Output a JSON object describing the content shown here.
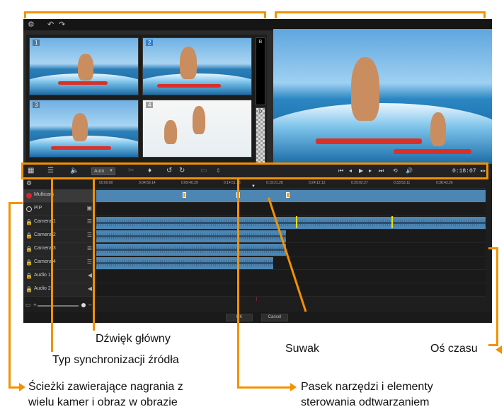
{
  "colors": {
    "callout": "#f39200",
    "clip": "#4d86b3",
    "record": "#d9252b",
    "app_bg": "#2a2a2a"
  },
  "camera_grid": {
    "cells": [
      {
        "num": "1"
      },
      {
        "num": "2"
      },
      {
        "num": "3"
      },
      {
        "num": "4"
      }
    ],
    "side_slots": [
      {
        "label": "B"
      },
      {
        "label": "0"
      }
    ]
  },
  "toolbar": {
    "audio_select_value": "Auto",
    "time_readout": "0:18:07 ◂▸"
  },
  "timeline": {
    "ruler_ticks": [
      "00:00:00",
      "0:04:59.14",
      "0:09:40.29",
      "0:14:51.13",
      "0:19:21.28",
      "0:24:12.12",
      "0:29:02.27",
      "0:33:53.11",
      "0:38:43.26"
    ],
    "tracks": [
      {
        "name": "Multicam"
      },
      {
        "name": "PIP"
      },
      {
        "name": "Camera 1"
      },
      {
        "name": "Camera 2"
      },
      {
        "name": "Camera 3"
      },
      {
        "name": "Camera 4"
      },
      {
        "name": "Audio 1"
      },
      {
        "name": "Audio 2"
      }
    ],
    "zoom": {
      "minus": "–",
      "plus": "+"
    }
  },
  "dialog": {
    "ok_label": "OK",
    "cancel_label": "Cancel"
  },
  "callouts": {
    "sync_type": "Typ synchronizacji źródła",
    "main_audio": "Dźwięk główny",
    "slider": "Suwak",
    "timeline_axis": "Oś czasu",
    "tracks": "Ścieżki zawierające nagrania z wielu kamer i obraz w obrazie",
    "tracks_line1": "Ścieżki zawierające nagrania z",
    "tracks_line2": "wielu kamer i obraz w obrazie",
    "toolbar": "Pasek narzędzi i elementy sterowania odtwarzaniem",
    "toolbar_line1": "Pasek narzędzi i elementy",
    "toolbar_line2": "sterowania odtwarzaniem"
  }
}
